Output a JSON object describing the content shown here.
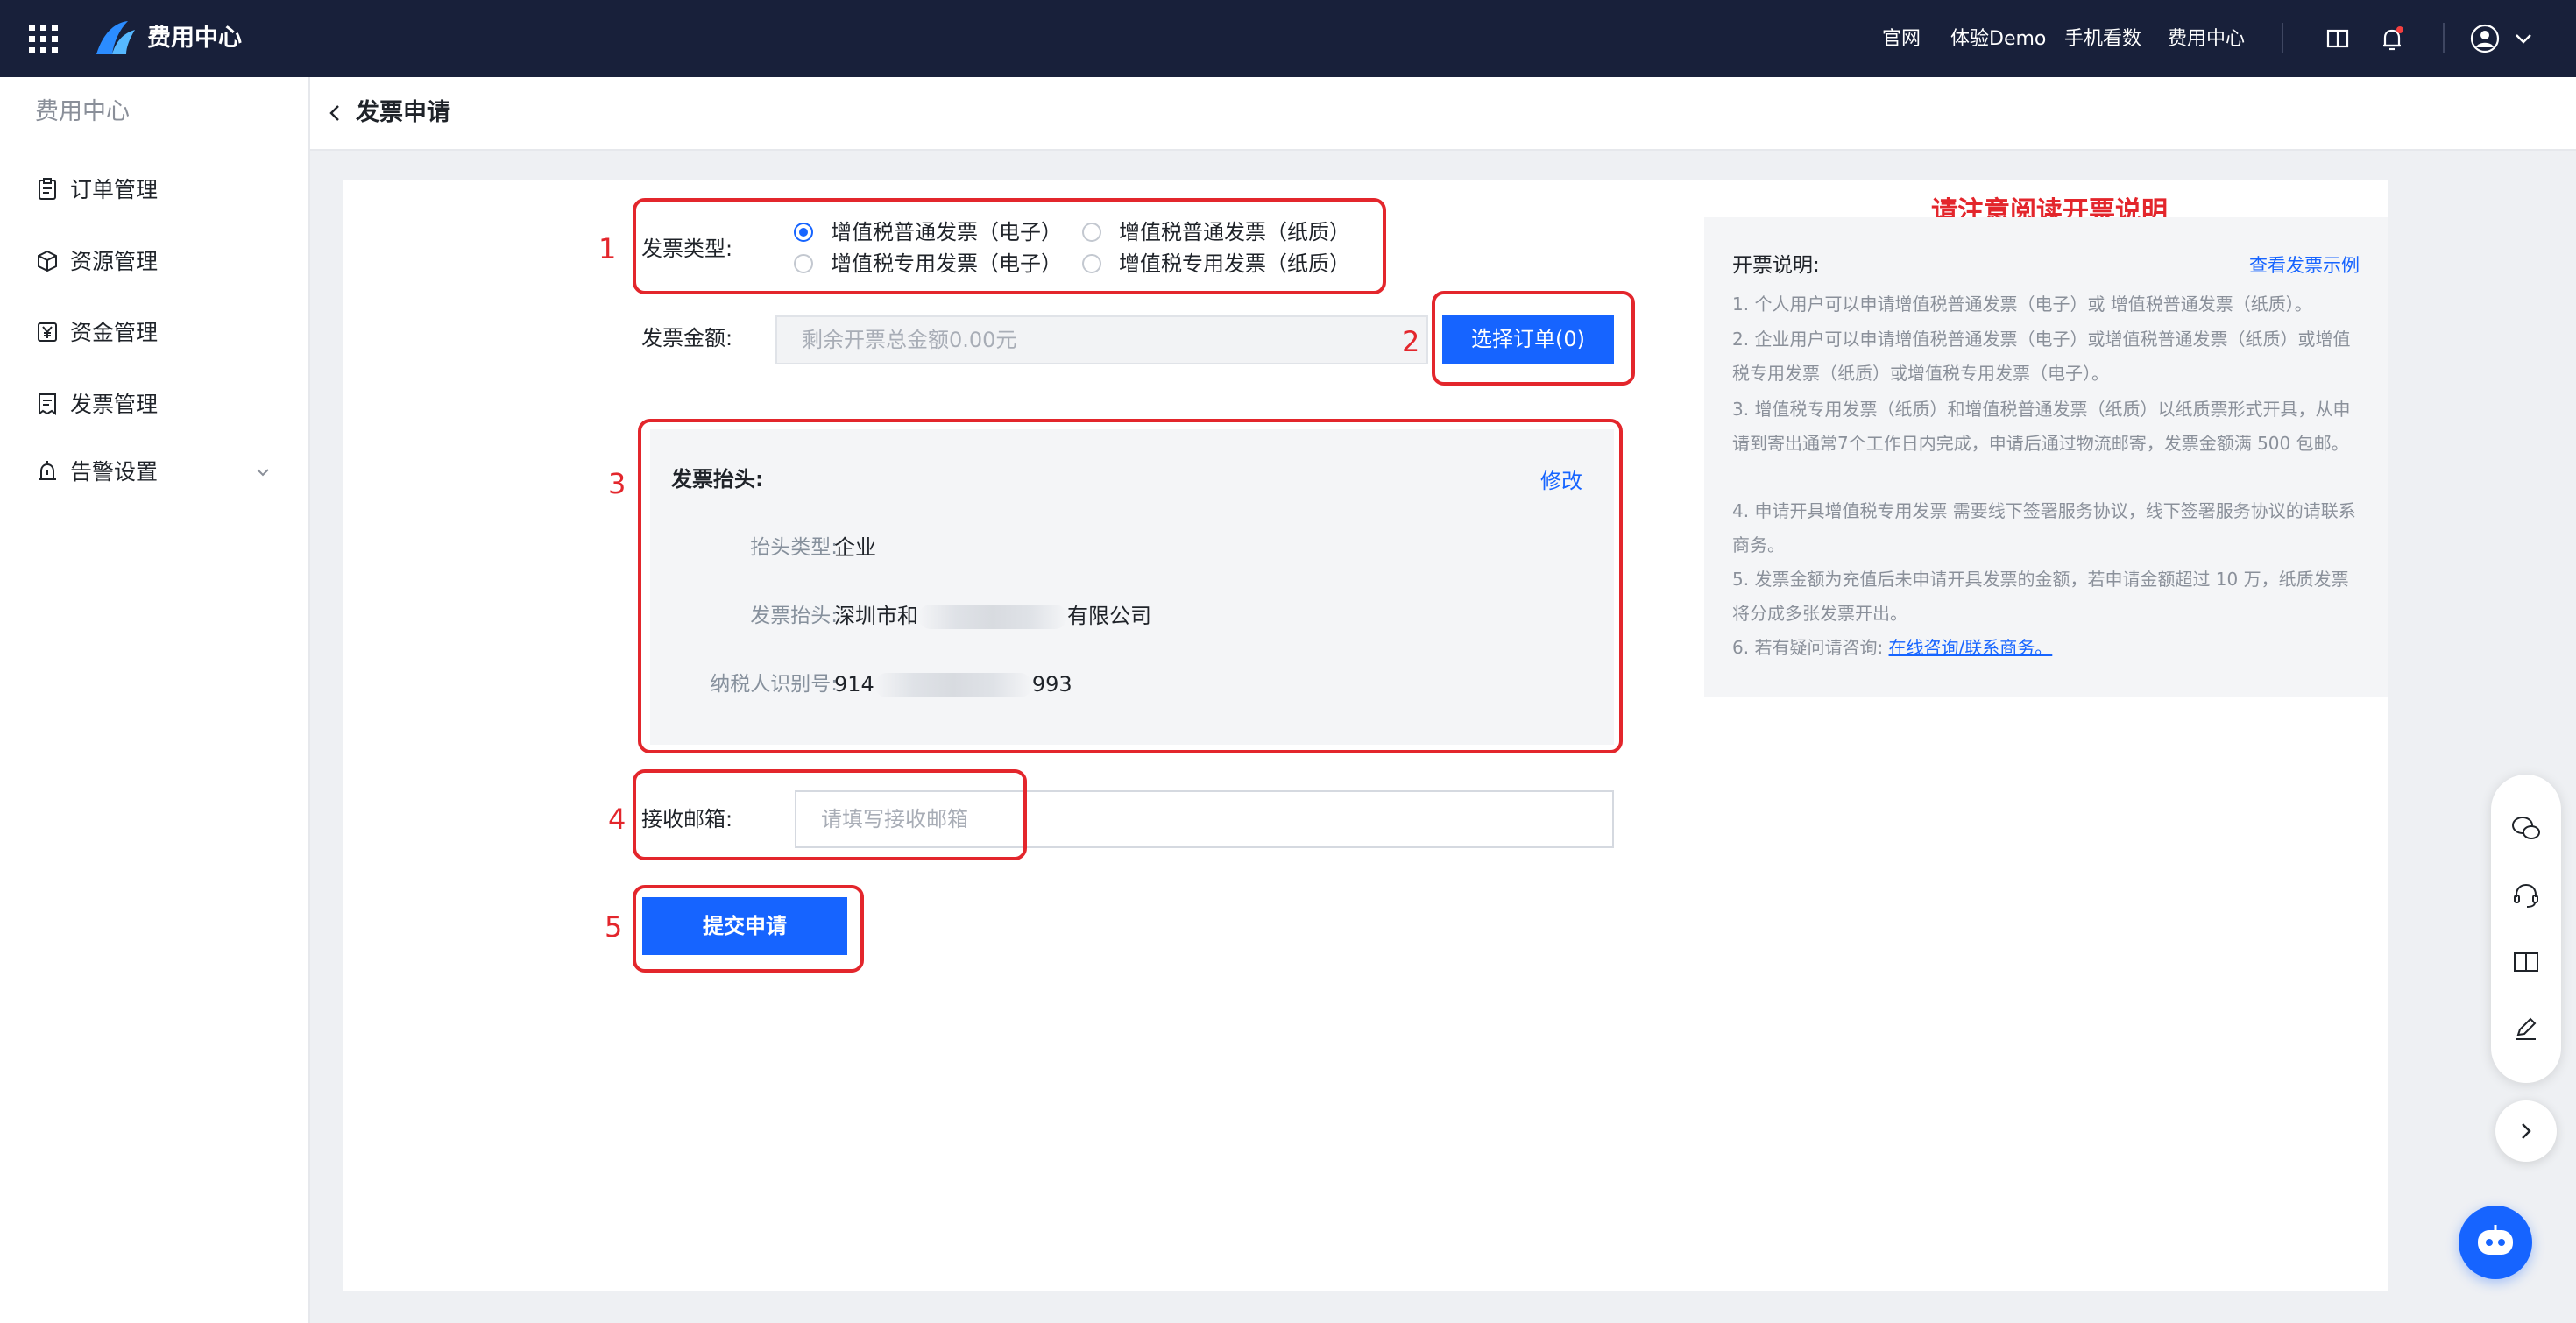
{
  "topnav": {
    "brand": "费用中心",
    "links": [
      "官网",
      "体验Demo",
      "手机看数",
      "费用中心"
    ]
  },
  "sidebar": {
    "title": "费用中心",
    "items": [
      {
        "label": "订单管理",
        "icon": "order-icon"
      },
      {
        "label": "资源管理",
        "icon": "cube-icon"
      },
      {
        "label": "资金管理",
        "icon": "yuan-icon"
      },
      {
        "label": "发票管理",
        "icon": "invoice-icon"
      },
      {
        "label": "告警设置",
        "icon": "alarm-icon"
      }
    ]
  },
  "page": {
    "title": "发票申请"
  },
  "form": {
    "invoice_type_label": "发票类型:",
    "invoice_types": [
      {
        "label": "增值税普通发票（电子）",
        "selected": true
      },
      {
        "label": "增值税普通发票（纸质）",
        "selected": false
      },
      {
        "label": "增值税专用发票（电子）",
        "selected": false
      },
      {
        "label": "增值税专用发票（纸质）",
        "selected": false
      }
    ],
    "amount_label": "发票金额:",
    "amount_placeholder": "剩余开票总金额0.00元",
    "select_order_label": "选择订单(0)",
    "header": {
      "title": "发票抬头:",
      "edit_label": "修改",
      "type_label": "抬头类型:",
      "type_value": "企业",
      "name_label": "发票抬头:",
      "name_prefix": "深圳市和",
      "name_suffix": "有限公司",
      "tax_label": "纳税人识别号:",
      "tax_prefix": "914",
      "tax_suffix": "993"
    },
    "email_label": "接收邮箱:",
    "email_placeholder": "请填写接收邮箱",
    "submit_label": "提交申请"
  },
  "annotations": {
    "numbers": [
      "1",
      "2",
      "3",
      "4",
      "5"
    ],
    "note": "请注意阅读开票说明"
  },
  "notes": {
    "title": "开票说明:",
    "example_link": "查看发票示例",
    "items": [
      "1. 个人用户可以申请增值税普通发票（电子）或 增值税普通发票（纸质）。",
      "2. 企业用户可以申请增值税普通发票（电子）或增值税普通发票（纸质）或增值税专用发票（纸质）或增值税专用发票（电子）。",
      "3. 增值税专用发票（纸质）和增值税普通发票（纸质）以纸质票形式开具，从申请到寄出通常7个工作日内完成，申请后通过物流邮寄，发票金额满 500 包邮。",
      "4. 申请开具增值税专用发票 需要线下签署服务协议，线下签署服务协议的请联系商务。",
      "5. 发票金额为充值后未申请开具发票的金额，若申请金额超过 10 万，纸质发票将分成多张发票开出。"
    ],
    "last_prefix": "6. 若有疑问请咨询:",
    "last_link": "在线咨询/联系商务。"
  },
  "colors": {
    "accent": "#1664ff",
    "annotation": "#e3262c",
    "nav_bg": "#18203a"
  }
}
